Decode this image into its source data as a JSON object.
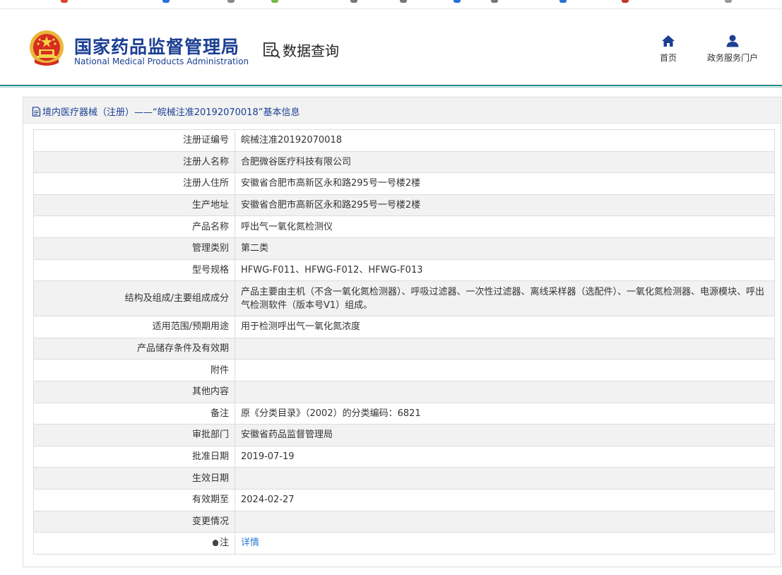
{
  "header": {
    "brand_cn": "国家药品监督管理局",
    "brand_en": "National Medical Products Administration",
    "query_label": "数据查询",
    "nav": [
      {
        "label": "首页",
        "icon": "home-icon"
      },
      {
        "label": "政务服务门户",
        "icon": "user-icon"
      }
    ]
  },
  "panel": {
    "title": "境内医疗器械（注册）——“皖械注准20192070018”基本信息"
  },
  "rows": [
    {
      "label": "注册证编号",
      "value": "皖械注准20192070018"
    },
    {
      "label": "注册人名称",
      "value": "合肥微谷医疗科技有限公司"
    },
    {
      "label": "注册人住所",
      "value": "安徽省合肥市高新区永和路295号一号楼2楼"
    },
    {
      "label": "生产地址",
      "value": "安徽省合肥市高新区永和路295号一号楼2楼"
    },
    {
      "label": "产品名称",
      "value": "呼出气一氧化氮检测仪"
    },
    {
      "label": "管理类别",
      "value": "第二类"
    },
    {
      "label": "型号规格",
      "value": "HFWG-F011、HFWG-F012、HFWG-F013"
    },
    {
      "label": "结构及组成/主要组成成分",
      "value": "产品主要由主机（不含一氧化氮检测器）、呼吸过滤器、一次性过滤器、离线采样器（选配件）、一氧化氮检测器、电源模块、呼出气检测软件（版本号V1）组成。"
    },
    {
      "label": "适用范围/预期用途",
      "value": "用于检测呼出气一氧化氮浓度"
    },
    {
      "label": "产品储存条件及有效期",
      "value": ""
    },
    {
      "label": "附件",
      "value": ""
    },
    {
      "label": "其他内容",
      "value": ""
    },
    {
      "label": "备注",
      "value": "原《分类目录》（2002）的分类编码：6821"
    },
    {
      "label": "审批部门",
      "value": "安徽省药品监督管理局"
    },
    {
      "label": "批准日期",
      "value": "2019-07-19"
    },
    {
      "label": "生效日期",
      "value": ""
    },
    {
      "label": "有效期至",
      "value": "2024-02-27"
    },
    {
      "label": "变更情况",
      "value": ""
    },
    {
      "label": "注",
      "value": "详情"
    }
  ],
  "colors": {
    "brand": "#1b3f93",
    "divider": "#1d8b86",
    "link": "#2a7ad5"
  }
}
